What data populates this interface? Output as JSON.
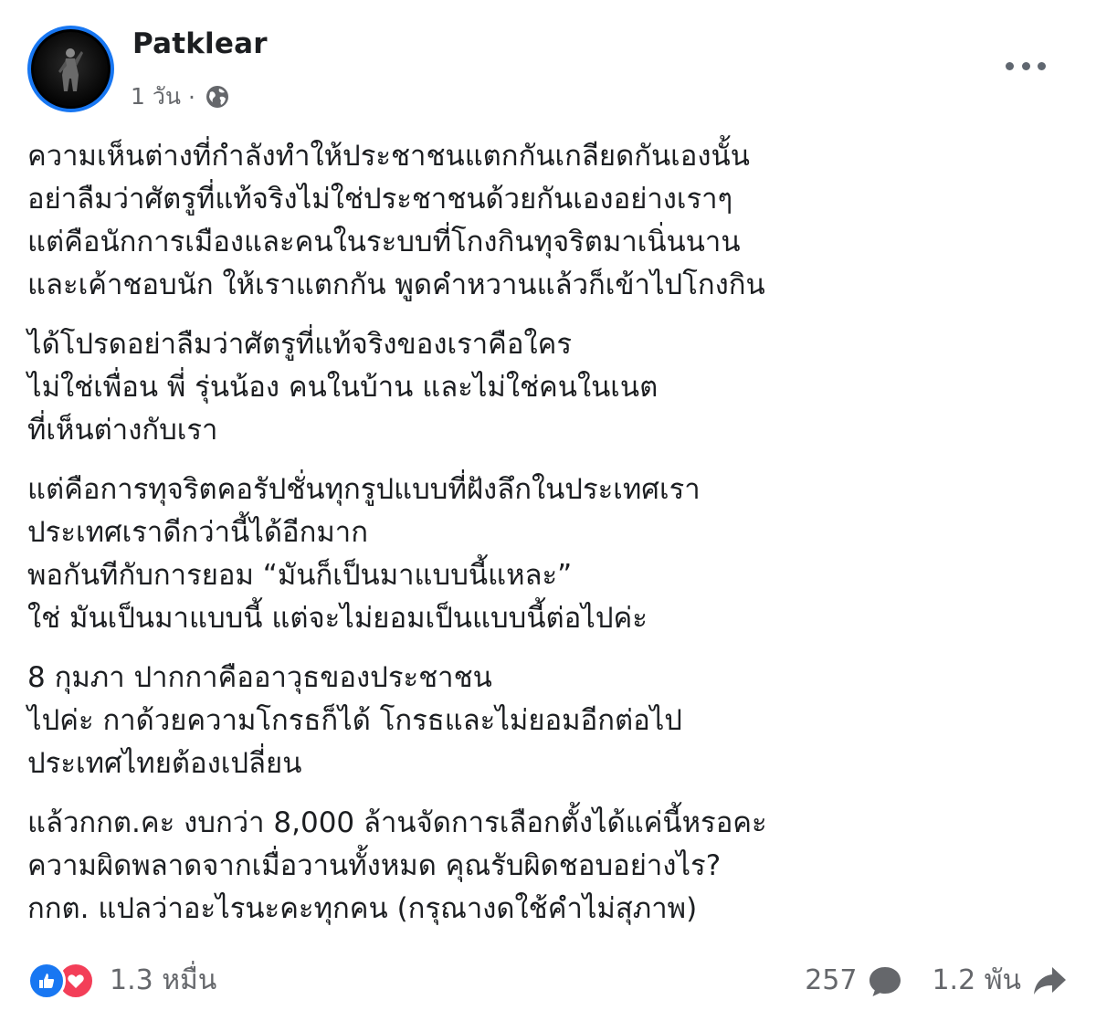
{
  "post": {
    "author": "Patklear",
    "time": "1 วัน",
    "separator": "·",
    "privacy_icon": "globe-icon",
    "more_icon": "more-dots-icon",
    "paragraphs": [
      [
        "ความเห็นต่างที่กำลังทำให้ประชาชนแตกกันเกลียดกันเองนั้น",
        "อย่าลืมว่าศัตรูที่แท้จริงไม่ใช่ประชาชนด้วยกันเองอย่างเราๆ",
        "แต่คือนักการเมืองและคนในระบบที่โกงกินทุจริตมาเนิ่นนาน",
        "และเค้าชอบนัก ให้เราแตกกัน พูดคำหวานแล้วก็เข้าไปโกงกิน"
      ],
      [
        "ได้โปรดอย่าลืมว่าศัตรูที่แท้จริงของเราคือใคร",
        "ไม่ใช่เพื่อน พี่ รุ่นน้อง คนในบ้าน และไม่ใช่คนในเนต",
        "ที่เห็นต่างกับเรา"
      ],
      [
        "แต่คือการทุจริตคอรัปชั่นทุกรูปแบบที่ฝังลึกในประเทศเรา",
        "ประเทศเราดีกว่านี้ได้อีกมาก",
        "พอกันทีกับการยอม “มันก็เป็นมาแบบนี้แหละ”",
        "ใช่ มันเป็นมาแบบนี้ แต่จะไม่ยอมเป็นแบบนี้ต่อไปค่ะ"
      ],
      [
        "8 กุมภา ปากกาคืออาวุธของประชาชน",
        "ไปค่ะ กาด้วยความโกรธก็ได้ โกรธและไม่ยอมอีกต่อไป",
        "ประเทศไทยต้องเปลี่ยน"
      ],
      [
        "แล้วกกต.คะ งบกว่า 8,000 ล้านจัดการเลือกตั้งได้แค่นี้หรอคะ",
        "ความผิดพลาดจากเมื่อวานทั้งหมด คุณรับผิดชอบอย่างไร?",
        "กกต. แปลว่าอะไรนะคะทุกคน (กรุณางดใช้คำไม่สุภาพ)"
      ]
    ]
  },
  "footer": {
    "reaction_count": "1.3 หมื่น",
    "comment_count": "257",
    "share_count": "1.2 พัน",
    "icons": [
      "like-icon",
      "love-icon",
      "comment-icon",
      "share-icon"
    ]
  },
  "colors": {
    "text": "#1c1e21",
    "muted": "#65676b",
    "like": "#1877f2",
    "love": "#f33e58"
  }
}
